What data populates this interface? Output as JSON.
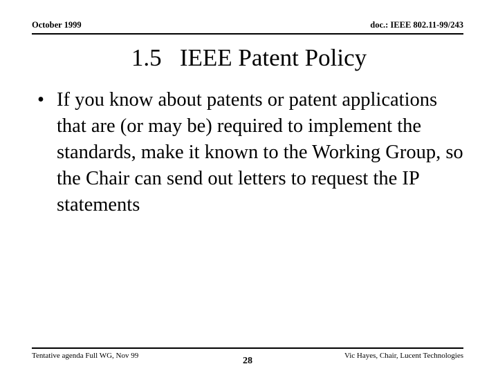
{
  "slide": {
    "header": {
      "left_text": "October 1999",
      "right_text": "doc.: IEEE 802.11-99/243"
    },
    "title": "1.5   IEEE Patent Policy",
    "bullets": [
      {
        "marker": "•",
        "text": "If you know about patents or patent applications that are (or may be) required to implement the standards, make it known to the Working Group, so the Chair can send out letters to request the IP statements"
      }
    ],
    "footer": {
      "left_text": "Tentative agenda Full WG, Nov 99",
      "page_number": "28",
      "right_text": "Vic Hayes, Chair, Lucent Technologies"
    },
    "colors": {
      "background": "#ffffff",
      "text": "#000000",
      "rule": "#000000"
    }
  }
}
